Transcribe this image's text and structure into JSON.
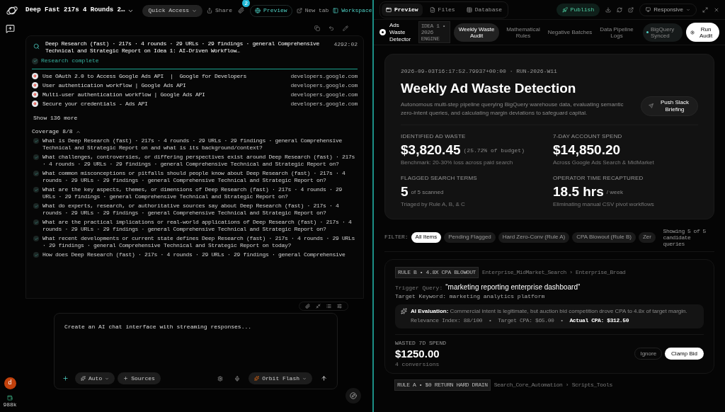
{
  "left": {
    "topbar": {
      "title": "Deep Fast 217s 4 Rounds 2…",
      "quick_access": "Quick Access",
      "share": "Share",
      "attach_badge": "2",
      "preview": "Preview",
      "new_tab": "New tab",
      "workspace": "Workspace"
    },
    "research": {
      "title": "Deep Research (fast) · 217s · 4 rounds · 29 URLs · 29 findings · general Comprehensive Technical and Strategic Report on Idea 1: AI-Driven Workflow…",
      "time": "4292:02",
      "status": "Research complete",
      "sources": [
        {
          "title": "Use OAuth 2.0 to Access Google Ads API  |  Google for Developers",
          "domain": "developers.google.com"
        },
        {
          "title": "User authentication workflow | Google Ads API",
          "domain": "developers.google.com"
        },
        {
          "title": "Multi-user authentication workflow | Google Ads API",
          "domain": "developers.google.com"
        },
        {
          "title": "Secure your credentials - Ads API",
          "domain": "developers.google.com"
        }
      ],
      "show_more": "Show 136 more",
      "coverage": "Coverage 8/8",
      "coverage_expanded": true,
      "questions": [
        {
          "text": "What is Deep Research (fast) · 217s · 4 rounds · 29 URLs · 29 findings · general Comprehensive Technical and Strategic Report on and what is its background/context?",
          "checked": true
        },
        {
          "text": "What challenges, controversies, or differing perspectives exist around Deep Research (fast) · 217s · 4 rounds · 29 URLs · 29 findings · general Comprehensive Technical and Strategic Report on?",
          "checked": true
        },
        {
          "text": "What common misconceptions or pitfalls should people know about Deep Research (fast) · 217s · 4 rounds · 29 URLs · 29 findings · general Comprehensive Technical and Strategic Report on?",
          "checked": true
        },
        {
          "text": "What are the key aspects, themes, or dimensions of Deep Research (fast) · 217s · 4 rounds · 29 URLs · 29 findings · general Comprehensive Technical and Strategic Report on?",
          "checked": true
        },
        {
          "text": "What do experts, research, or authoritative sources say about Deep Research (fast) · 217s · 4 rounds · 29 URLs · 29 findings · general Comprehensive Technical and Strategic Report on?",
          "checked": true
        },
        {
          "text": "What are the practical implications or real-world applications of Deep Research (fast) · 217s · 4 rounds · 29 URLs · 29 findings · general Comprehensive Technical and Strategic Report on?",
          "checked": true
        },
        {
          "text": "What recent developments or current state defines Deep Research (fast) · 217s · 4 rounds · 29 URLs · 29 findings · general Comprehensive Technical and Strategic Report on today?",
          "checked": true
        },
        {
          "text": "How does Deep Research (fast) · 217s · 4 rounds · 29 URLs · 29 findings · general Comprehensive",
          "checked": true
        }
      ]
    },
    "composer": {
      "placeholder": "Create an AI chat interface with streaming responses...",
      "mode": "Auto",
      "sources": "Sources",
      "model": "Orbit Flash"
    },
    "user": {
      "initial": "d",
      "credits": "988k"
    }
  },
  "right": {
    "tabs": [
      {
        "label": "Preview",
        "selected": true
      },
      {
        "label": "Files",
        "selected": false
      },
      {
        "label": "Database",
        "selected": false
      }
    ],
    "publish": "Publish",
    "device": "Responsive",
    "app": {
      "name": "Ads Waste Detector",
      "badge": "IDEA 1 • 2026 ENGINE",
      "nav": [
        {
          "label": "Weekly Waste Audit",
          "selected": true
        },
        {
          "label": "Mathematical Rules",
          "selected": false
        },
        {
          "label": "Negative Batches",
          "selected": false
        },
        {
          "label": "Data Pipeline Logs",
          "selected": false
        }
      ],
      "sync": "BigQuery Synced",
      "run": "Run Audit",
      "hero": {
        "meta": "2026-09-03T16:17:52.79937+00:00 · RUN-2026-W11",
        "title": "Weekly Ad Waste Detection",
        "description": "Autonomous multi-step pipeline querying BigQuery warehouse data, evaluating semantic zero-intent queries, and calculating margin deviations to safeguard capital.",
        "action": "Push Slack Briefing",
        "stats": [
          {
            "label": "IDENTIFIED AD WASTE",
            "value": "$3,820.45",
            "suffix": "(25.72% of budget)",
            "note": "Benchmark: 20-30% loss across paid search",
            "kind": "mono"
          },
          {
            "label": "7-DAY ACCOUNT SPEND",
            "value": "$14,850.20",
            "note": "Across Google Ads Search & MidMarket"
          },
          {
            "label": "FLAGGED SEARCH TERMS",
            "value": "5",
            "suffix": "of 5 scanned",
            "note": "Triaged by Rule A, B, & C",
            "kind": "plain"
          },
          {
            "label": "OPERATOR TIME RECAPTURED",
            "value": "18.5 hrs",
            "suffix": "/ week",
            "note": "Eliminating manual CSV pivot workflows",
            "kind": "plain"
          }
        ]
      },
      "filter_label": "FILTER:",
      "filters": [
        {
          "label": "All Items",
          "selected": true
        },
        {
          "label": "Pending Flagged",
          "selected": false
        },
        {
          "label": "Hard Zero-Conv (Rule A)",
          "selected": false
        },
        {
          "label": "CPA Blowout (Rule B)",
          "selected": false
        },
        {
          "label": "Zer",
          "selected": false
        }
      ],
      "showing": "Showing 5 of 5 candidate queries",
      "findings": [
        {
          "rule": "RULE B • 4.8X CPA BLOWOUT",
          "path": "Enterprise_MidMarket_Search › Enterprise_Broad",
          "trigger_label": "Trigger Query:",
          "trigger": "“marketing reporting enterprise dashboard”",
          "keyword": "Target Keyword: marketing analytics platform",
          "eval": "**AI Evaluation:** Commercial intent is legitimate, but auction bid competition drove CPA to 4.8x of target margin.",
          "metrics": "Relevance Index: 88/100  •  Target CPA: $65.00  •  **Actual CPA: $312.50**",
          "spend_label": "WASTED 7D SPEND",
          "spend": "$1250.00",
          "conversions": "4 conversions",
          "ignore": "Ignore",
          "action": "Clamp Bid"
        },
        {
          "rule": "RULE A • $0 RETURN HARD DRAIN",
          "path": "Search_Core_Automation › Scripts_Tools"
        }
      ]
    }
  }
}
